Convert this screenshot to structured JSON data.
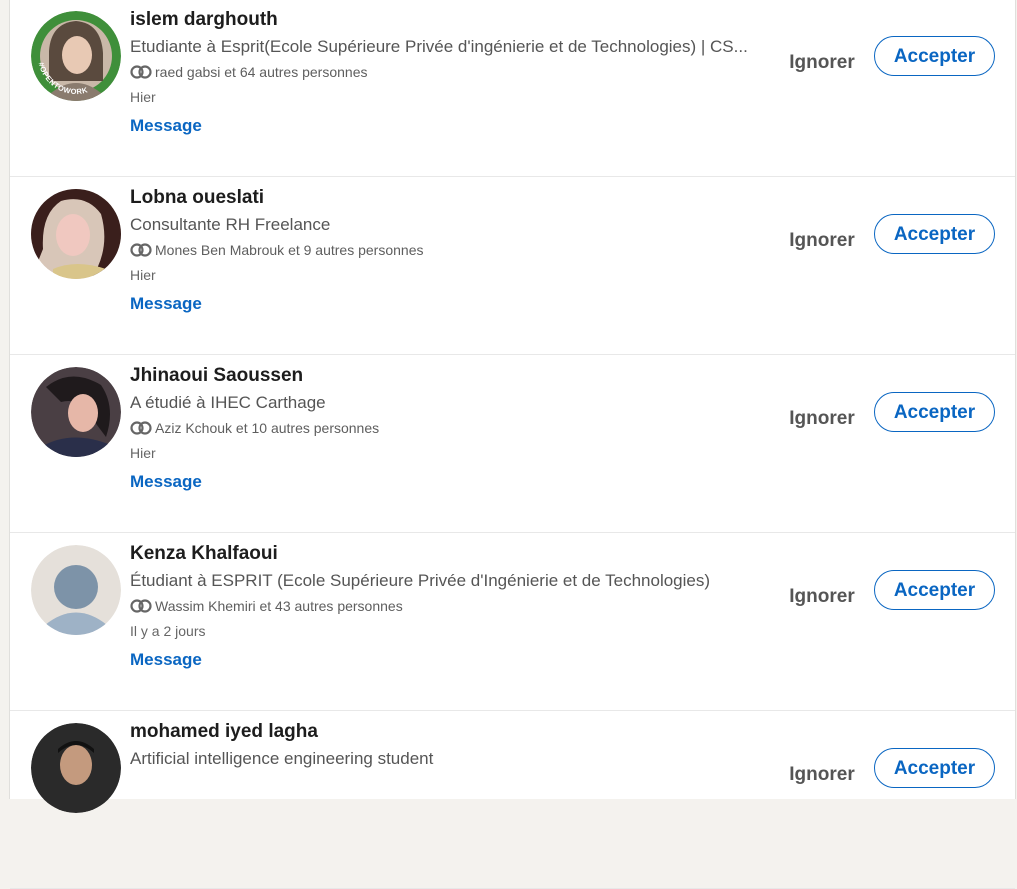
{
  "labels": {
    "ignore": "Ignorer",
    "accept": "Accepter",
    "message": "Message"
  },
  "colors": {
    "accent": "#0a66c2",
    "open_to_work_ring": "#3f8f3a"
  },
  "invitations": [
    {
      "name": "islem darghouth",
      "headline": "Etudiante à Esprit(Ecole Supérieure Privée d'ingénierie et de Technologies) | CS...",
      "mutual": "raed gabsi et 64 autres personnes",
      "time": "Hier",
      "badge": "#OPENTOWORK"
    },
    {
      "name": "Lobna oueslati",
      "headline": "Consultante RH Freelance",
      "mutual": "Mones Ben Mabrouk et 9 autres personnes",
      "time": "Hier"
    },
    {
      "name": "Jhinaoui Saoussen",
      "headline": "A étudié à IHEC Carthage",
      "mutual": "Aziz Kchouk et 10 autres personnes",
      "time": "Hier"
    },
    {
      "name": "Kenza Khalfaoui",
      "headline": "Étudiant à ESPRIT (Ecole Supérieure Privée d'Ingénierie et de Technologies)",
      "mutual": "Wassim Khemiri et 43 autres personnes",
      "time": "Il y a 2 jours"
    },
    {
      "name": "mohamed iyed lagha",
      "headline": "Artificial intelligence engineering student",
      "mutual": "",
      "time": ""
    }
  ]
}
